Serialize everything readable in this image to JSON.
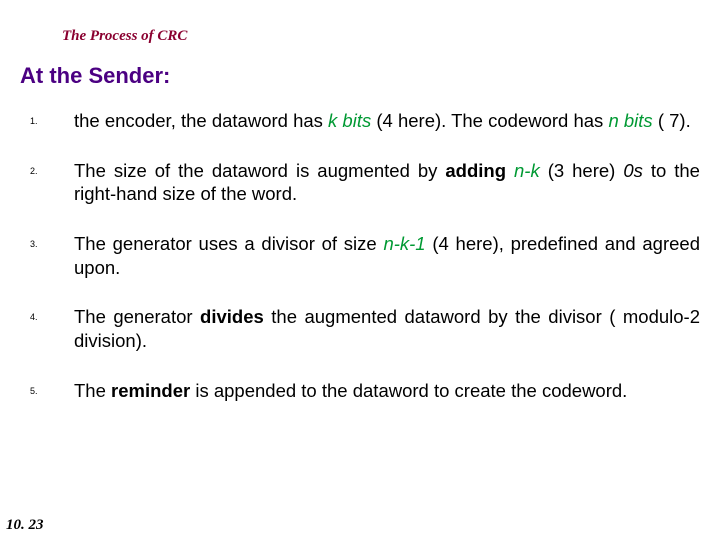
{
  "title": "The Process of CRC",
  "heading": "At the Sender:",
  "items": [
    {
      "num": "1.",
      "t1": "the encoder, the dataword has ",
      "e1": "k bits ",
      "t2": "(4 here). The codeword has ",
      "e2": "n bits ",
      "t3": "( 7)."
    },
    {
      "num": "2.",
      "t1": "The size of the dataword is augmented by ",
      "b1": "adding ",
      "e1": "n-k ",
      "t2": "(3 here) ",
      "e2": "0s ",
      "t3": "to the right-hand size of the word."
    },
    {
      "num": "3.",
      "t1": "The generator uses a divisor of size ",
      "e1": "n-k-1 ",
      "t2": "(4 here), predefined and agreed upon."
    },
    {
      "num": "4.",
      "t1": "The generator ",
      "b1": "divides ",
      "t2": "the augmented dataword by the divisor ( modulo-2 division)."
    },
    {
      "num": "5.",
      "t1": "The ",
      "b1": "reminder ",
      "t2": "is appended to the dataword to create the codeword."
    }
  ],
  "footer": "10. 23"
}
